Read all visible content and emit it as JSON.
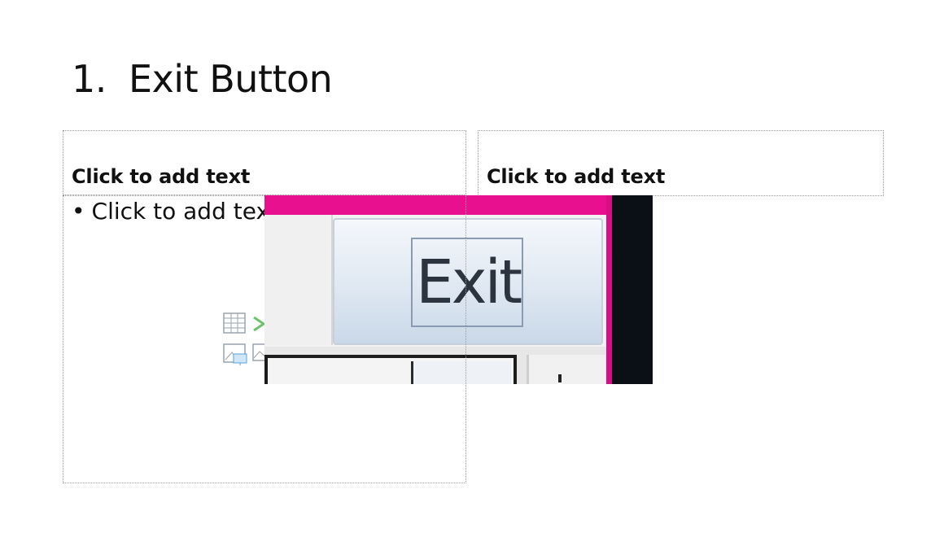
{
  "slide": {
    "title_number": "1.",
    "title_text": "Exit Button",
    "left_placeholder": {
      "header": "Click to add text",
      "bullet": "Click to add text"
    },
    "right_placeholder": {
      "header": "Click to add text"
    },
    "insert_icons": [
      "table-icon",
      "chart-icon",
      "picture-icon",
      "online-picture-icon"
    ],
    "image": {
      "button_label": "Exit",
      "colors": {
        "titlebar": "#e8108f",
        "frame": "#0b1016",
        "button": "#dfe8f2"
      }
    }
  }
}
